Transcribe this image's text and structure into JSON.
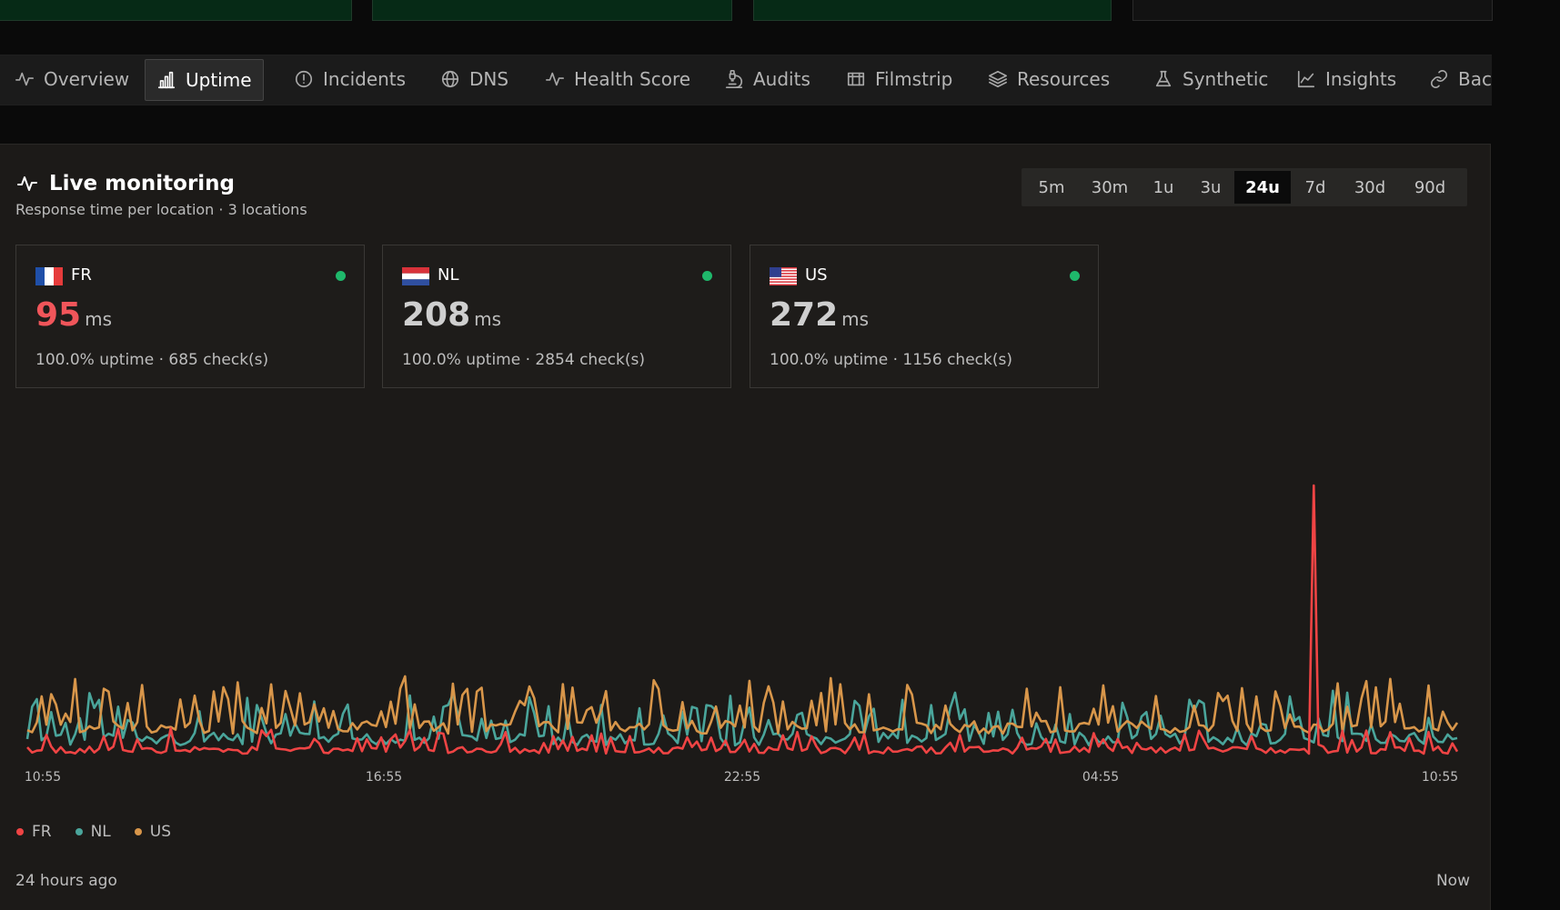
{
  "tabs": [
    {
      "label": "Overview",
      "icon": "activity-icon"
    },
    {
      "label": "Uptime",
      "icon": "bar-chart-icon",
      "active": true
    },
    {
      "label": "Incidents",
      "icon": "alert-circle-icon"
    },
    {
      "label": "DNS",
      "icon": "globe-icon"
    },
    {
      "label": "Health Score",
      "icon": "activity-icon"
    },
    {
      "label": "Audits",
      "icon": "microscope-icon"
    },
    {
      "label": "Filmstrip",
      "icon": "film-icon"
    },
    {
      "label": "Resources",
      "icon": "layers-icon"
    },
    {
      "label": "Synthetic",
      "icon": "flask-icon"
    },
    {
      "label": "Insights",
      "icon": "line-chart-icon"
    },
    {
      "label": "Bac",
      "icon": "link-icon"
    }
  ],
  "panel": {
    "title": "Live monitoring",
    "subtitle": "Response time per location · 3 locations"
  },
  "ranges": [
    {
      "label": "5m"
    },
    {
      "label": "30m"
    },
    {
      "label": "1u"
    },
    {
      "label": "3u"
    },
    {
      "label": "24u",
      "active": true
    },
    {
      "label": "7d"
    },
    {
      "label": "30d"
    },
    {
      "label": "90d"
    }
  ],
  "locations": [
    {
      "code": "FR",
      "value": "95",
      "unit": "ms",
      "meta": "100.0% uptime · 685 check(s)",
      "status": "up"
    },
    {
      "code": "NL",
      "value": "208",
      "unit": "ms",
      "meta": "100.0% uptime · 2854 check(s)",
      "status": "up"
    },
    {
      "code": "US",
      "value": "272",
      "unit": "ms",
      "meta": "100.0% uptime · 1156 check(s)",
      "status": "up"
    }
  ],
  "colors": {
    "FR": "#ef4444",
    "NL": "#4aa59b",
    "US": "#d8964a",
    "status_up": "#1fb86b",
    "accent_active": "#ffffff"
  },
  "chart_data": {
    "type": "line",
    "x_tick_labels": [
      "10:55",
      "16:55",
      "22:55",
      "04:55",
      "10:55"
    ],
    "ylabel": "",
    "series": [
      {
        "name": "FR"
      },
      {
        "name": "NL"
      },
      {
        "name": "US"
      }
    ],
    "legend_position": "bottom-left",
    "grid": false
  },
  "footer": {
    "left": "24 hours ago",
    "right": "Now"
  }
}
